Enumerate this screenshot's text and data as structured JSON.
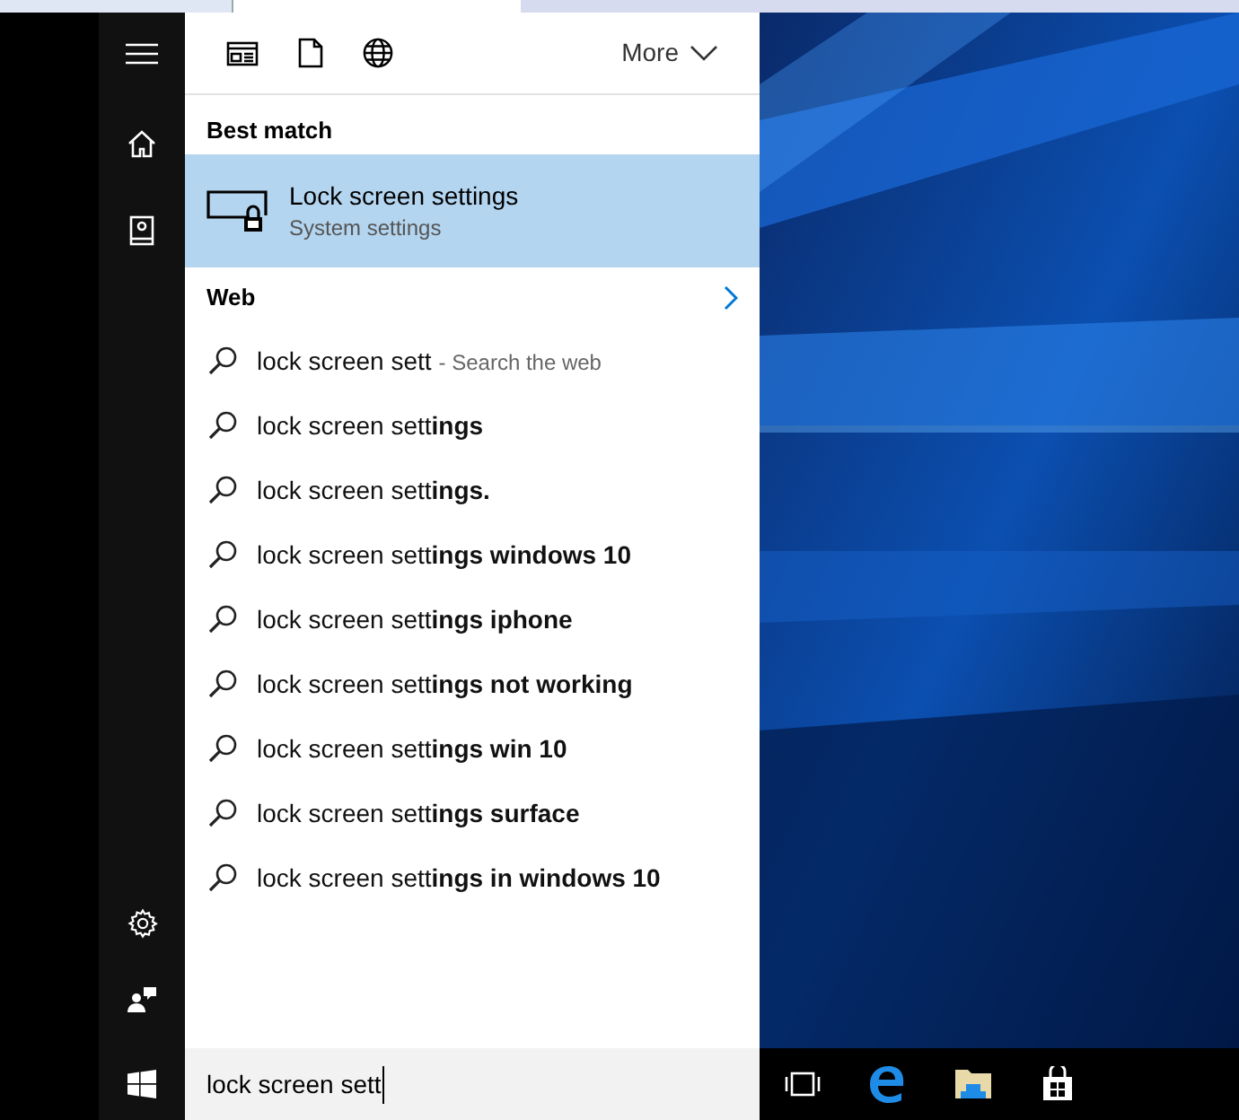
{
  "filters": {
    "more": "More"
  },
  "best_match": {
    "heading": "Best match",
    "title": "Lock screen settings",
    "subtitle": "System settings",
    "selected": true
  },
  "web": {
    "heading": "Web"
  },
  "suggestions": [
    {
      "text": "lock screen sett",
      "hint": "- Search the web"
    },
    {
      "text": "lock screen sett**ings**"
    },
    {
      "text": "lock screen sett**ings.**"
    },
    {
      "text": "lock screen sett**ings windows 10**"
    },
    {
      "text": "lock screen sett**ings iphone**"
    },
    {
      "text": "lock screen sett**ings not working**"
    },
    {
      "text": "lock screen sett**ings win 10**"
    },
    {
      "text": "lock screen sett**ings surface**"
    },
    {
      "text": "lock screen sett**ings in windows 10**"
    }
  ],
  "search_box": {
    "value": "lock screen sett"
  }
}
